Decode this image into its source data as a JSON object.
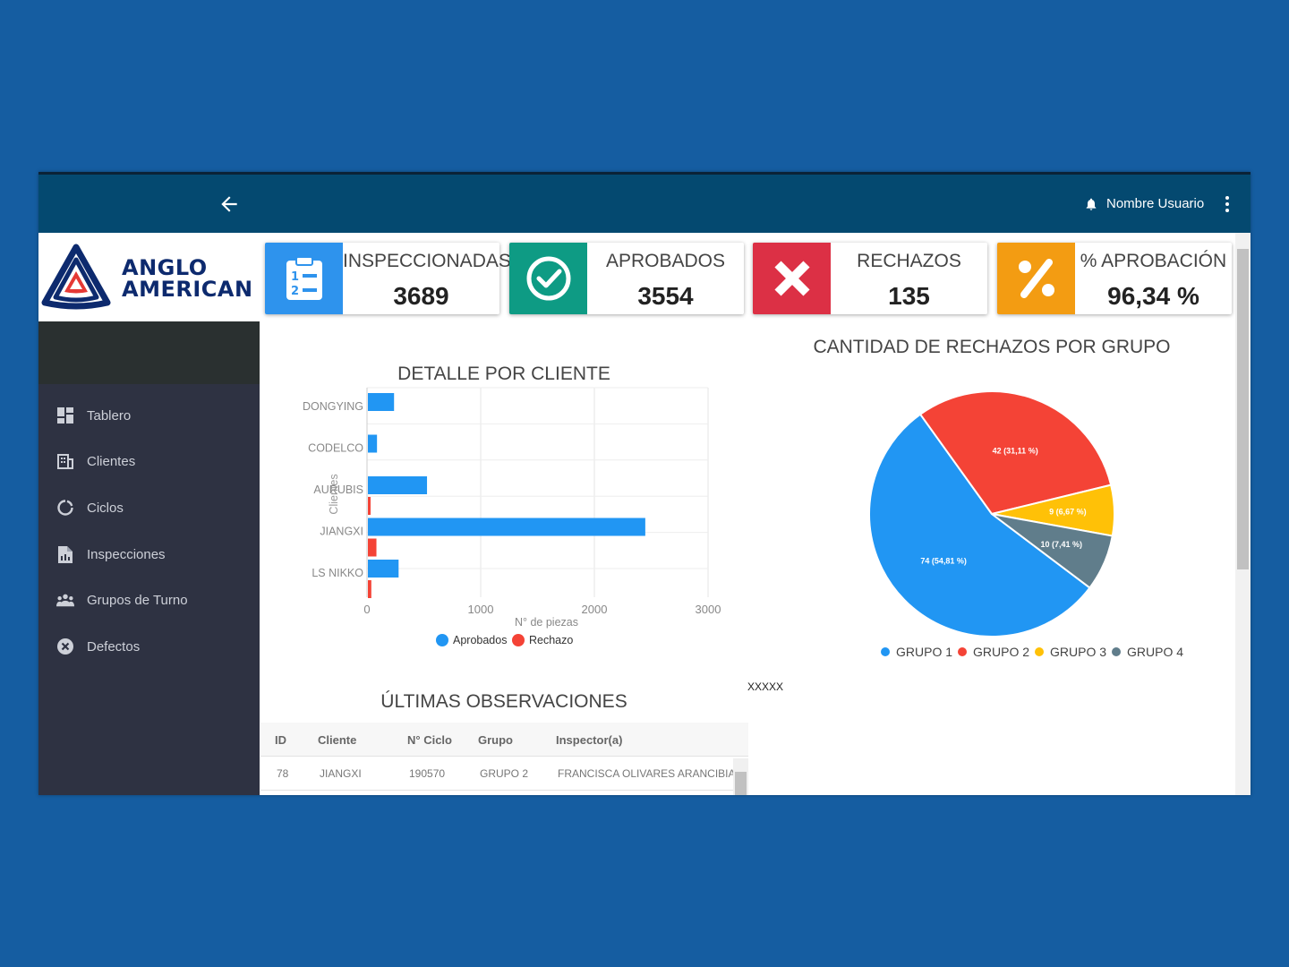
{
  "topbar": {
    "user_name": "Nombre Usuario",
    "back_icon": "arrow-left-icon",
    "bell_icon": "bell-icon",
    "menu_icon": "kebab-icon"
  },
  "logo": {
    "line1": "ANGLO",
    "line2": "AMERICAN"
  },
  "sidebar": {
    "items": [
      {
        "label": "Tablero",
        "icon": "dashboard-icon"
      },
      {
        "label": "Clientes",
        "icon": "building-icon"
      },
      {
        "label": "Ciclos",
        "icon": "cycle-icon"
      },
      {
        "label": "Inspecciones",
        "icon": "document-icon"
      },
      {
        "label": "Grupos de Turno",
        "icon": "group-icon"
      },
      {
        "label": "Defectos",
        "icon": "x-circle-icon"
      }
    ]
  },
  "kpis": [
    {
      "label": "INSPECCIONADAS",
      "value": "3689",
      "color": "#2e93ed",
      "icon": "clipboard-list-icon"
    },
    {
      "label": "APROBADOS",
      "value": "3554",
      "color": "#0e9b84",
      "icon": "check-circle-icon"
    },
    {
      "label": "RECHAZOS",
      "value": "135",
      "color": "#dc3045",
      "icon": "x-icon"
    },
    {
      "label": "% APROBACIÓN",
      "value": "96,34 %",
      "color": "#f39c12",
      "icon": "percent-icon"
    }
  ],
  "bar_title": "DETALLE POR CLIENTE",
  "pie_title": "CANTIDAD DE RECHAZOS POR GRUPO",
  "placeholder_text": "XXXXX",
  "table_title": "ÚLTIMAS OBSERVACIONES",
  "table": {
    "headers": [
      "ID",
      "Cliente",
      "N° Ciclo",
      "Grupo",
      "Inspector(a)"
    ],
    "rows": [
      [
        "78",
        "JIANGXI",
        "190570",
        "GRUPO 2",
        "FRANCISCA OLIVARES ARANCIBIA"
      ]
    ]
  },
  "chart_data": [
    {
      "type": "bar",
      "orientation": "horizontal",
      "title": "DETALLE POR CLIENTE",
      "categories": [
        "DONGYING",
        "CODELCO",
        "AURUBIS",
        "JIANGXI",
        "LS NIKKO"
      ],
      "series": [
        {
          "name": "Aprobados",
          "color": "#2196f3",
          "values": [
            230,
            80,
            520,
            2440,
            270
          ]
        },
        {
          "name": "Rechazo",
          "color": "#f44336",
          "values": [
            0,
            0,
            15,
            75,
            30
          ]
        }
      ],
      "xlabel": "N° de piezas",
      "ylabel": "Clientes",
      "xlim": [
        0,
        3000
      ],
      "xticks": [
        0,
        1000,
        2000,
        3000
      ],
      "grid": true,
      "legend": "bottom"
    },
    {
      "type": "pie",
      "title": "CANTIDAD DE RECHAZOS POR GRUPO",
      "slices": [
        {
          "name": "GRUPO 1",
          "value": 74,
          "label": "74 (54,81 %)",
          "color": "#2196f3"
        },
        {
          "name": "GRUPO 2",
          "value": 42,
          "label": "42 (31,11 %)",
          "color": "#f44336"
        },
        {
          "name": "GRUPO 3",
          "value": 9,
          "label": "9 (6,67 %)",
          "color": "#ffc107"
        },
        {
          "name": "GRUPO 4",
          "value": 10,
          "label": "10 (7,41 %)",
          "color": "#607d8b"
        }
      ],
      "legend": "bottom"
    }
  ]
}
